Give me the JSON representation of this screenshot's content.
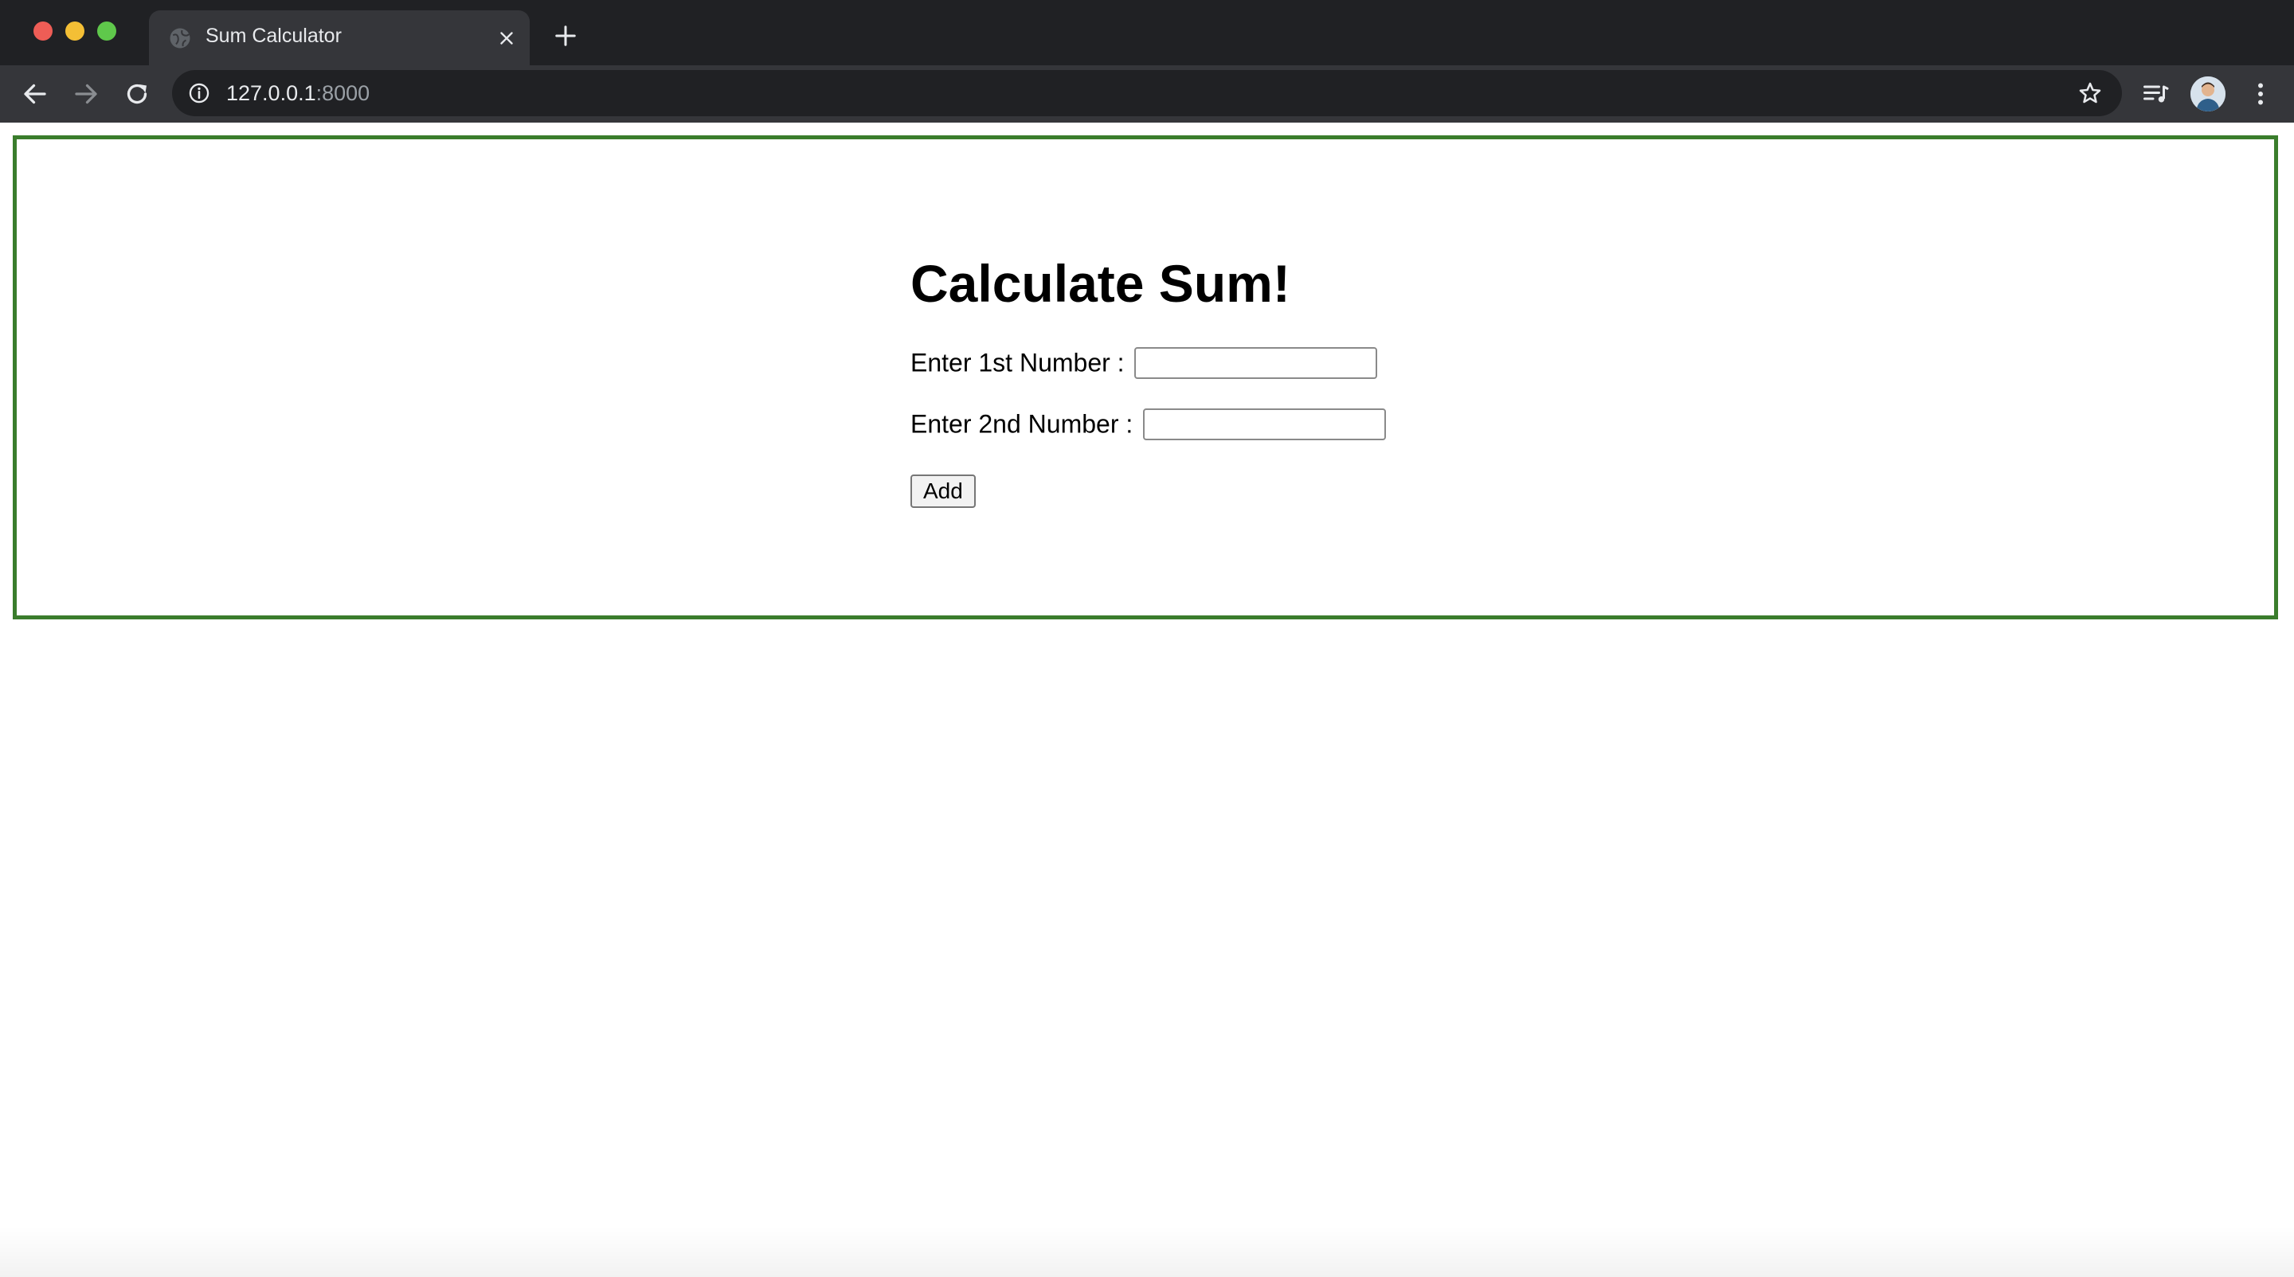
{
  "browser": {
    "tab": {
      "title": "Sum Calculator"
    },
    "address_bar": {
      "host": "127.0.0.1",
      "port": ":8000"
    }
  },
  "page": {
    "title": "Calculate Sum!",
    "first_number": {
      "label": "Enter 1st Number :",
      "value": ""
    },
    "second_number": {
      "label": "Enter 2nd Number :",
      "value": ""
    },
    "add_button": {
      "label": "Add"
    }
  },
  "colors": {
    "frame_border": "#3a7d2c",
    "chrome_background": "#202124",
    "toolbar_background": "#35363a"
  },
  "icons": {
    "tab": [
      "globe-icon",
      "close-icon",
      "plus-icon"
    ],
    "toolbar": [
      "arrow-left-icon",
      "arrow-right-icon",
      "reload-icon",
      "info-icon",
      "star-icon",
      "media-queue-icon",
      "avatar",
      "kebab-menu-icon"
    ]
  }
}
